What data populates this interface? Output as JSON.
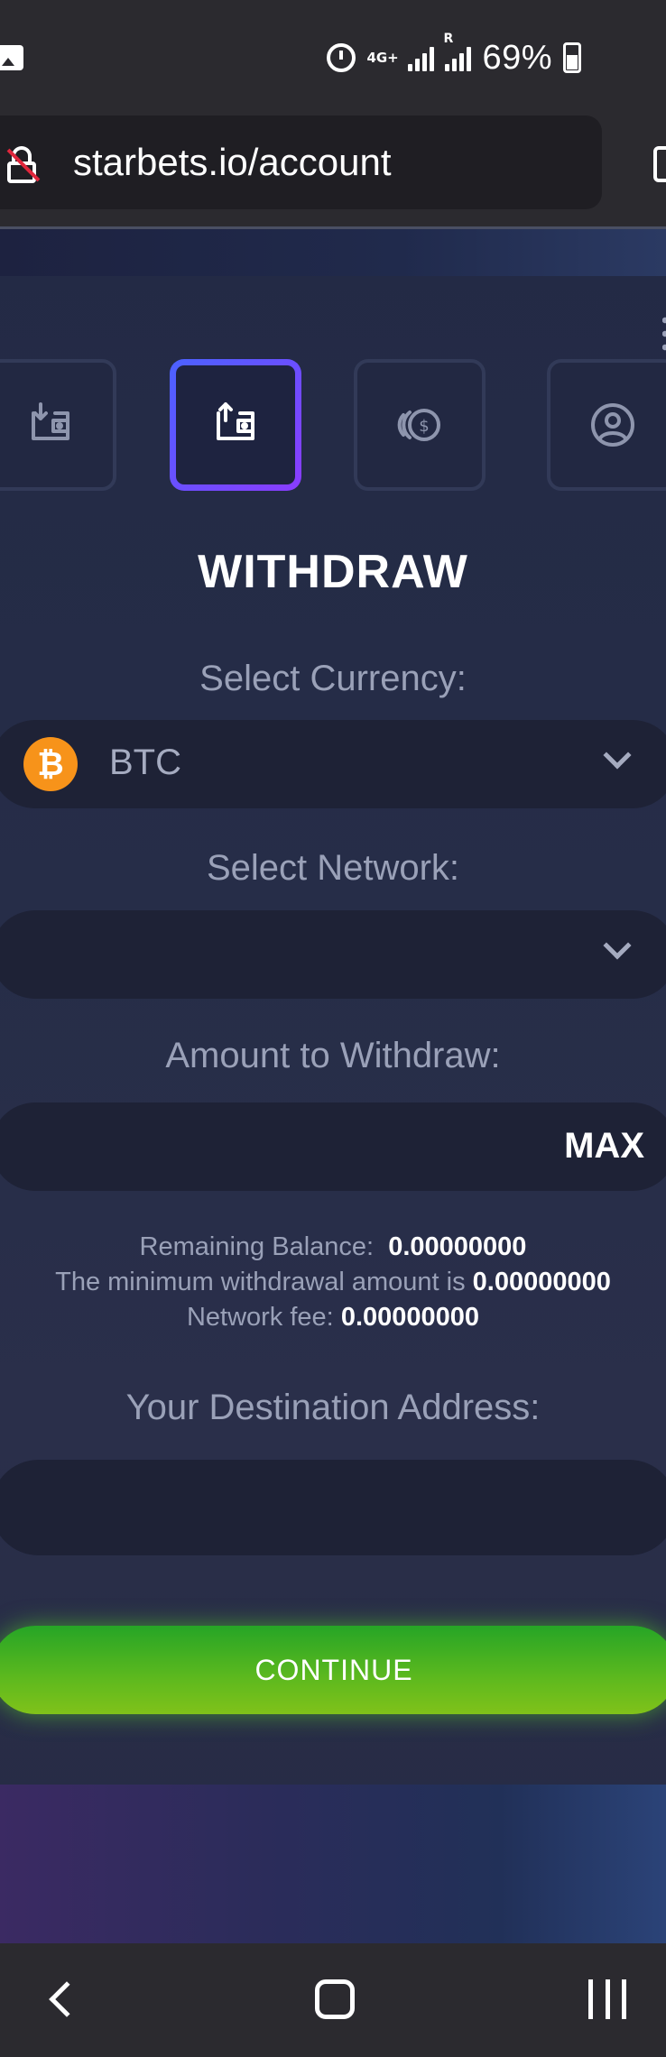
{
  "status_bar": {
    "network_type": "4G+",
    "roaming_indicator": "R",
    "battery_percent": "69%",
    "icons": [
      "gallery-icon",
      "alarm-icon",
      "signal-icon",
      "battery-icon"
    ]
  },
  "browser": {
    "url": "starbets.io/account",
    "icons": [
      "not-secure-lock-icon",
      "tab-switcher-icon"
    ]
  },
  "account_tabs": [
    {
      "name": "deposit",
      "icon": "wallet-in-icon",
      "active": false
    },
    {
      "name": "withdraw",
      "icon": "wallet-out-icon",
      "active": true
    },
    {
      "name": "tip",
      "icon": "coin-icon",
      "active": false
    },
    {
      "name": "profile",
      "icon": "user-icon",
      "active": false
    }
  ],
  "withdraw": {
    "title": "WITHDRAW",
    "currency_label": "Select Currency:",
    "currency_value": "BTC",
    "currency_icon": "bitcoin-icon",
    "network_label": "Select Network:",
    "network_value": "",
    "amount_label": "Amount to Withdraw:",
    "amount_value": "",
    "max_label": "MAX",
    "remaining_balance_label": "Remaining Balance:",
    "remaining_balance_value": "0.00000000",
    "minimum_label": "The minimum withdrawal amount is",
    "minimum_value": "0.00000000",
    "fee_label": "Network fee:",
    "fee_value": "0.00000000",
    "destination_label": "Your Destination Address:",
    "destination_value": "",
    "continue_label": "CONTINUE"
  },
  "colors": {
    "accent_gradient_start": "#4b62ff",
    "accent_gradient_end": "#8a3cff",
    "bitcoin": "#f7931a",
    "continue_green": "#5eb91e",
    "page_background": "#262d48"
  },
  "nav_bar": {
    "icons": [
      "back-icon",
      "home-icon",
      "recent-apps-icon"
    ]
  }
}
